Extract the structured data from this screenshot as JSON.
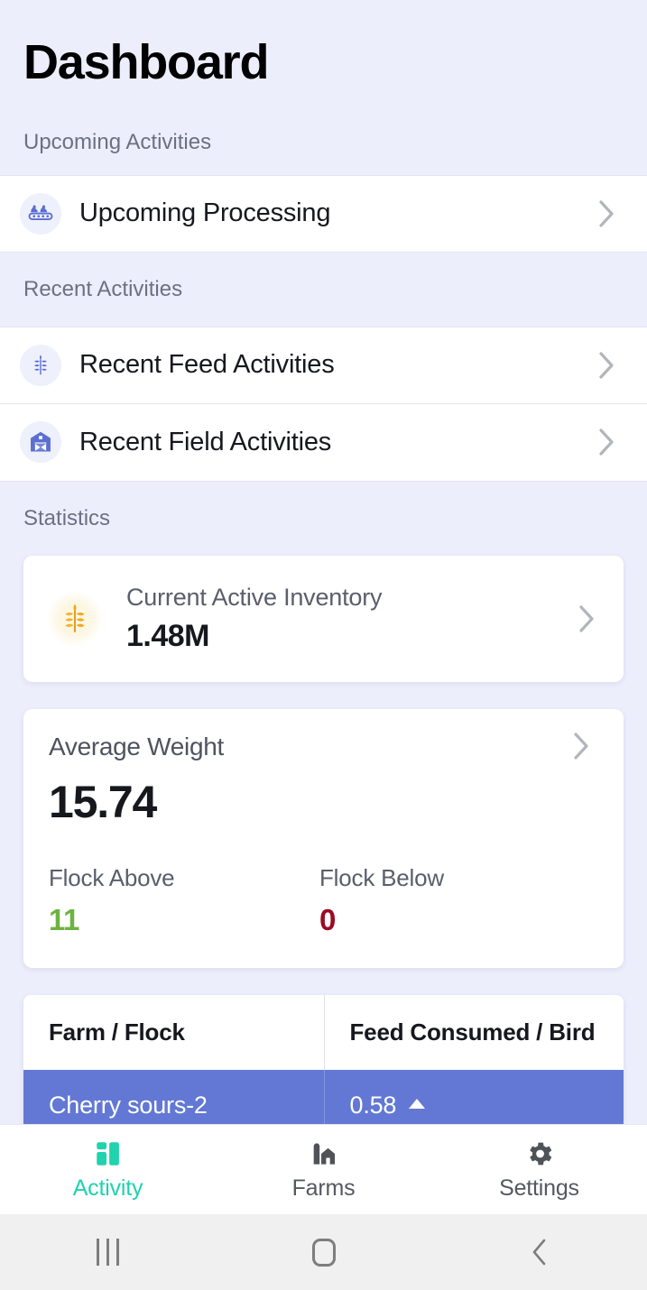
{
  "header": {
    "title": "Dashboard"
  },
  "sections": {
    "upcoming": {
      "title": "Upcoming Activities",
      "items": [
        {
          "label": "Upcoming Processing",
          "icon": "conveyor-birds-icon"
        }
      ]
    },
    "recent": {
      "title": "Recent Activities",
      "items": [
        {
          "label": "Recent Feed Activities",
          "icon": "wheat-icon"
        },
        {
          "label": "Recent Field Activities",
          "icon": "barn-icon"
        }
      ]
    },
    "statistics": {
      "title": "Statistics",
      "inventory": {
        "label": "Current Active Inventory",
        "value": "1.48M",
        "icon": "wheat-gold-icon"
      },
      "average_weight": {
        "label": "Average Weight",
        "value": "15.74",
        "flock_above_label": "Flock Above",
        "flock_above_value": "11",
        "flock_below_label": "Flock Below",
        "flock_below_value": "0"
      },
      "table": {
        "columns": [
          "Farm / Flock",
          "Feed Consumed / Bird"
        ],
        "rows": [
          {
            "farm_flock": "Cherry sours-2",
            "feed_consumed": "0.58",
            "trend": "up",
            "highlighted": true
          }
        ]
      }
    }
  },
  "tabbar": {
    "tabs": [
      {
        "label": "Activity",
        "icon": "dashboard-grid-icon",
        "active": true
      },
      {
        "label": "Farms",
        "icon": "silo-barn-icon",
        "active": false
      },
      {
        "label": "Settings",
        "icon": "gear-icon",
        "active": false
      }
    ]
  },
  "system_nav": {
    "recents_label": "Recents",
    "home_label": "Home",
    "back_label": "Back"
  },
  "colors": {
    "background": "#eceefc",
    "accent_teal": "#1fd3ae",
    "row_highlight_blue": "#6278d4",
    "icon_blue": "#5b6fd0",
    "gold": "#f0a91e",
    "positive_green": "#6cb33f",
    "negative_red": "#9c0a22"
  }
}
